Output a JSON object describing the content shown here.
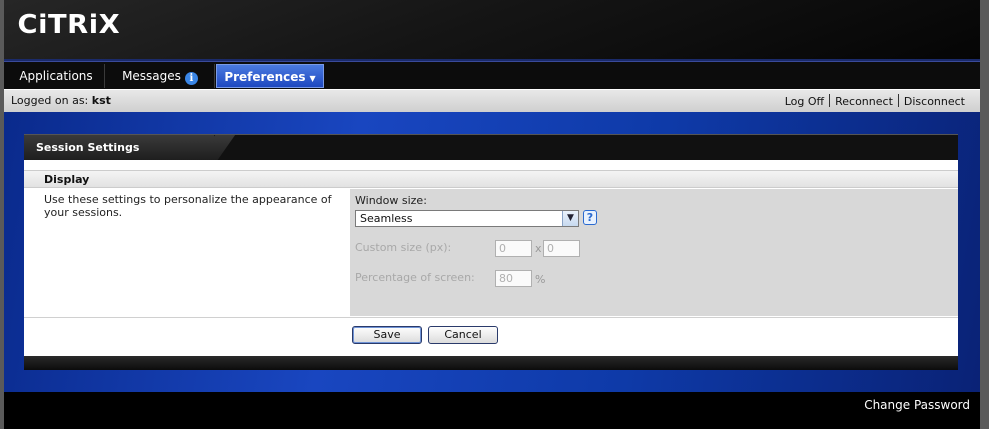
{
  "brand": {
    "logo_text": "CiTRiX"
  },
  "nav": {
    "tabs": [
      {
        "label": "Applications"
      },
      {
        "label": "Messages"
      },
      {
        "label": "Preferences"
      }
    ],
    "info_icon_text": "i",
    "dropdown_caret": "▼"
  },
  "status": {
    "logged_on_prefix": "Logged on as:",
    "user": "kst",
    "links": [
      "Log Off",
      "Reconnect",
      "Disconnect"
    ]
  },
  "panel": {
    "title": "Session Settings",
    "section_title": "Display",
    "description": "Use these settings to personalize the appearance of your sessions.",
    "window_size_label": "Window size:",
    "window_size_value": "Seamless",
    "help_icon_text": "?",
    "custom_size_label": "Custom size (px):",
    "custom_width": "0",
    "custom_sep": "x",
    "custom_height": "0",
    "percentage_label": "Percentage of screen:",
    "percentage_value": "80",
    "percentage_unit": "%",
    "save_label": "Save",
    "cancel_label": "Cancel"
  },
  "footer": {
    "change_password": "Change Password"
  },
  "colors": {
    "accent_blue": "#1946c0",
    "active_tab": "#2a58d0",
    "header_bg": "#151515"
  }
}
